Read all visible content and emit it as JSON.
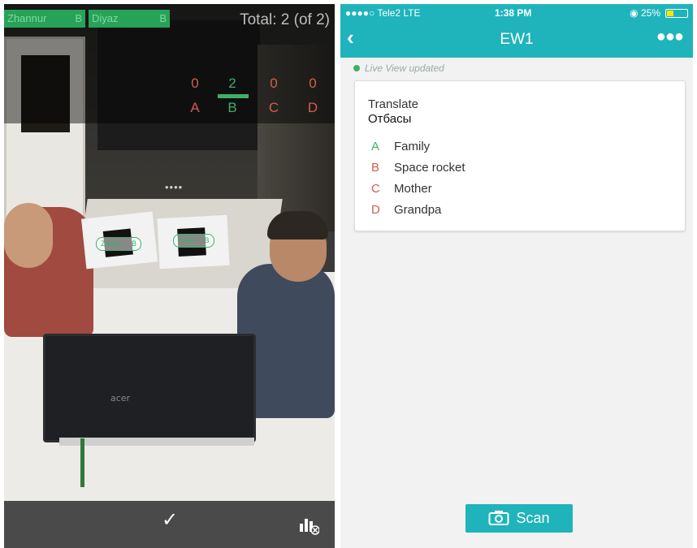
{
  "camera": {
    "students": [
      {
        "name": "Zhannur",
        "answer": "B"
      },
      {
        "name": "Diyaz",
        "answer": "B"
      }
    ],
    "total_text": "Total: 2 (of 2)",
    "counts": [
      {
        "letter": "A",
        "count": "0"
      },
      {
        "letter": "B",
        "count": "2"
      },
      {
        "letter": "C",
        "count": "0"
      },
      {
        "letter": "D",
        "count": "0"
      }
    ],
    "card_labels": [
      {
        "name": "Zhann...",
        "answer": "B"
      },
      {
        "name": "Diyaz",
        "answer": "B"
      }
    ],
    "laptop_brand": "acer",
    "loading_dots": "••••",
    "confirm_icon": "checkmark-icon",
    "stats_icon": "bar-chart-close-icon",
    "colors": {
      "correct": "#3cb068",
      "wrong": "#d35e4b"
    }
  },
  "phone": {
    "status": {
      "carrier": "●●●●○ Tele2  LTE",
      "time": "1:38 PM",
      "battery": "◉ 25%"
    },
    "nav": {
      "back_icon": "chevron-left-icon",
      "title": "EW1",
      "more_icon": "ellipsis-icon"
    },
    "live_text": "Live View updated",
    "question": {
      "type": "Translate",
      "text": "Отбасы",
      "options": [
        {
          "letter": "A",
          "text": "Family",
          "color": "#3cb068"
        },
        {
          "letter": "B",
          "text": "Space rocket",
          "color": "#d35e4b"
        },
        {
          "letter": "C",
          "text": "Mother",
          "color": "#d35e4b"
        },
        {
          "letter": "D",
          "text": "Grandpa",
          "color": "#d35e4b"
        }
      ]
    },
    "scan_label": "Scan",
    "accent": "#1fb4bb"
  }
}
